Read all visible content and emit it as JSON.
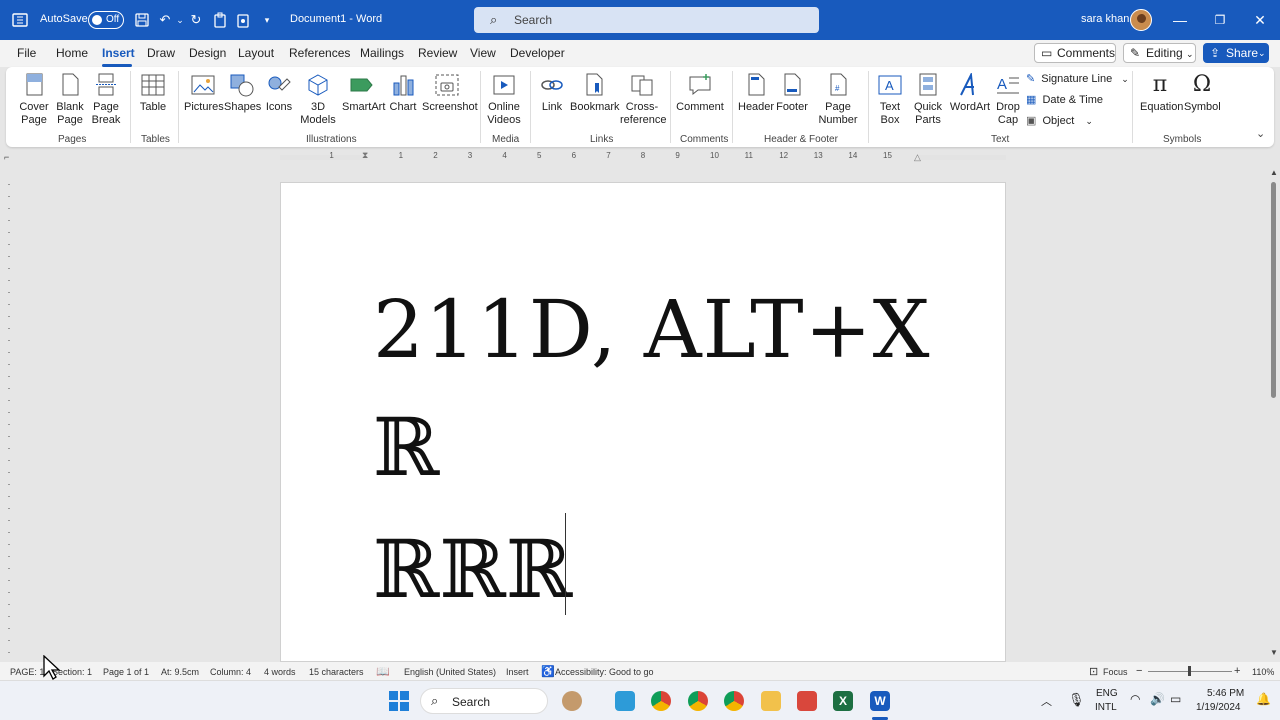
{
  "titlebar": {
    "autosave_label": "AutoSave",
    "autosave_state": "Off",
    "doc_title": "Document1  -  Word",
    "search_placeholder": "Search",
    "user_name": "sara khan"
  },
  "menu": {
    "tabs": [
      "File",
      "Home",
      "Insert",
      "Draw",
      "Design",
      "Layout",
      "References",
      "Mailings",
      "Review",
      "View",
      "Developer"
    ],
    "active_tab": "Insert",
    "comments_label": "Comments",
    "editing_label": "Editing",
    "share_label": "Share"
  },
  "ribbon": {
    "pages": {
      "cover_page": "Cover\nPage",
      "blank_page": "Blank\nPage",
      "page_break": "Page\nBreak",
      "group": "Pages"
    },
    "tables": {
      "table": "Table",
      "group": "Tables"
    },
    "illustrations": {
      "pictures": "Pictures",
      "shapes": "Shapes",
      "icons": "Icons",
      "models": "3D\nModels",
      "smartart": "SmartArt",
      "chart": "Chart",
      "screenshot": "Screenshot",
      "group": "Illustrations"
    },
    "media": {
      "online_videos": "Online\nVideos",
      "group": "Media"
    },
    "links": {
      "link": "Link",
      "bookmark": "Bookmark",
      "crossref": "Cross-\nreference",
      "group": "Links"
    },
    "comments": {
      "comment": "Comment",
      "group": "Comments"
    },
    "header_footer": {
      "header": "Header",
      "footer": "Footer",
      "page_number": "Page\nNumber",
      "group": "Header & Footer"
    },
    "text": {
      "text_box": "Text\nBox",
      "quick_parts": "Quick\nParts",
      "wordart": "WordArt",
      "drop_cap": "Drop\nCap",
      "signature_line": "Signature Line",
      "date_time": "Date & Time",
      "object": "Object",
      "group": "Text"
    },
    "symbols": {
      "equation": "Equation",
      "symbol": "Symbol",
      "group": "Symbols"
    }
  },
  "ruler_marks": [
    "1",
    "1",
    "2",
    "3",
    "4",
    "5",
    "6",
    "7",
    "8",
    "9",
    "10",
    "11",
    "12",
    "13",
    "14",
    "15"
  ],
  "document": {
    "line1": "211D, ALT+X",
    "line2": "ℝ",
    "line3": "ℝℝℝ"
  },
  "status": {
    "page": "PAGE: 1",
    "section": "Section: 1",
    "page_of": "Page 1 of 1",
    "at": "At: 9.5cm",
    "column": "Column: 4",
    "words": "4 words",
    "chars": "15 characters",
    "language": "English (United States)",
    "mode": "Insert",
    "accessibility": "Accessibility: Good to go",
    "focus": "Focus",
    "zoom": "110%"
  },
  "taskbar": {
    "search_label": "Search",
    "lang1": "ENG",
    "lang2": "INTL",
    "time": "5:46 PM",
    "date": "1/19/2024"
  },
  "colors": {
    "accent": "#185abd",
    "excel": "#1d6f42",
    "word": "#185abd"
  }
}
